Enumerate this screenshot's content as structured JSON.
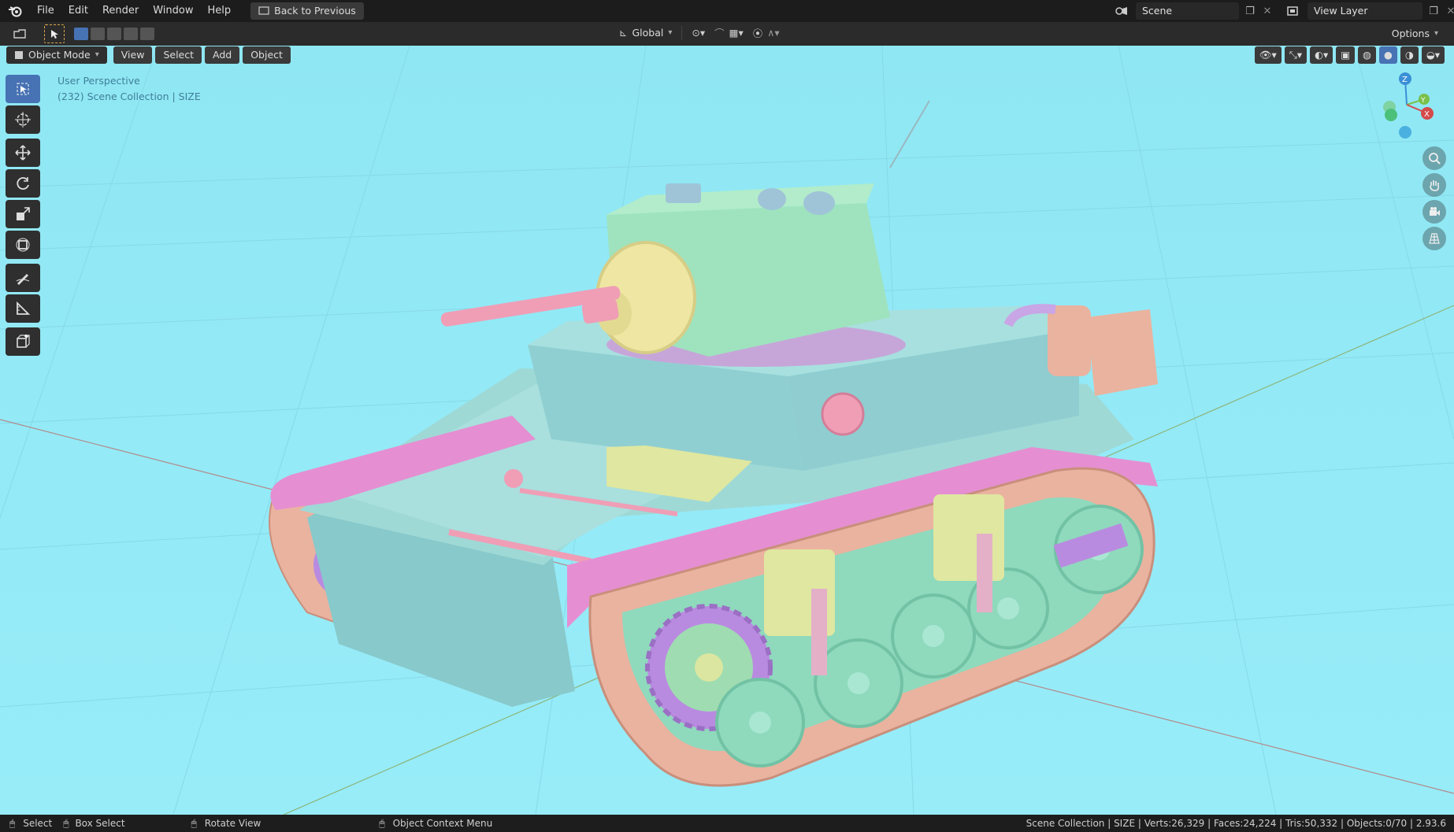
{
  "menubar": {
    "items": [
      "File",
      "Edit",
      "Render",
      "Window",
      "Help"
    ],
    "back_button": "Back to Previous",
    "scene_label": "Scene",
    "view_layer_label": "View Layer"
  },
  "toolbar": {
    "orientation": "Global",
    "options_label": "Options"
  },
  "viewport_header": {
    "mode": "Object Mode",
    "menus": [
      "View",
      "Select",
      "Add",
      "Object"
    ]
  },
  "overlay": {
    "perspective": "User Perspective",
    "collection_info": "(232) Scene Collection | SIZE"
  },
  "gizmo": {
    "axes": [
      "Z",
      "Y",
      "X"
    ]
  },
  "statusbar": {
    "select": "Select",
    "box_select": "Box Select",
    "rotate_view": "Rotate View",
    "context_menu": "Object Context Menu",
    "stats": "Scene Collection | SIZE | Verts:26,329 | Faces:24,224 | Tris:50,332 | Objects:0/70 | 2.93.6"
  },
  "colors": {
    "viewport_bg": "#93e9f6",
    "active_tool": "#4772b3",
    "hull": "#9ed9d6",
    "turret": "#9ee3be",
    "fender": "#e58fd2",
    "track": "#eab39f",
    "wheel": "#8fd9bd",
    "sprocket": "#b98be0",
    "mantlet": "#eee6a2",
    "gun": "#ef9eb6"
  }
}
